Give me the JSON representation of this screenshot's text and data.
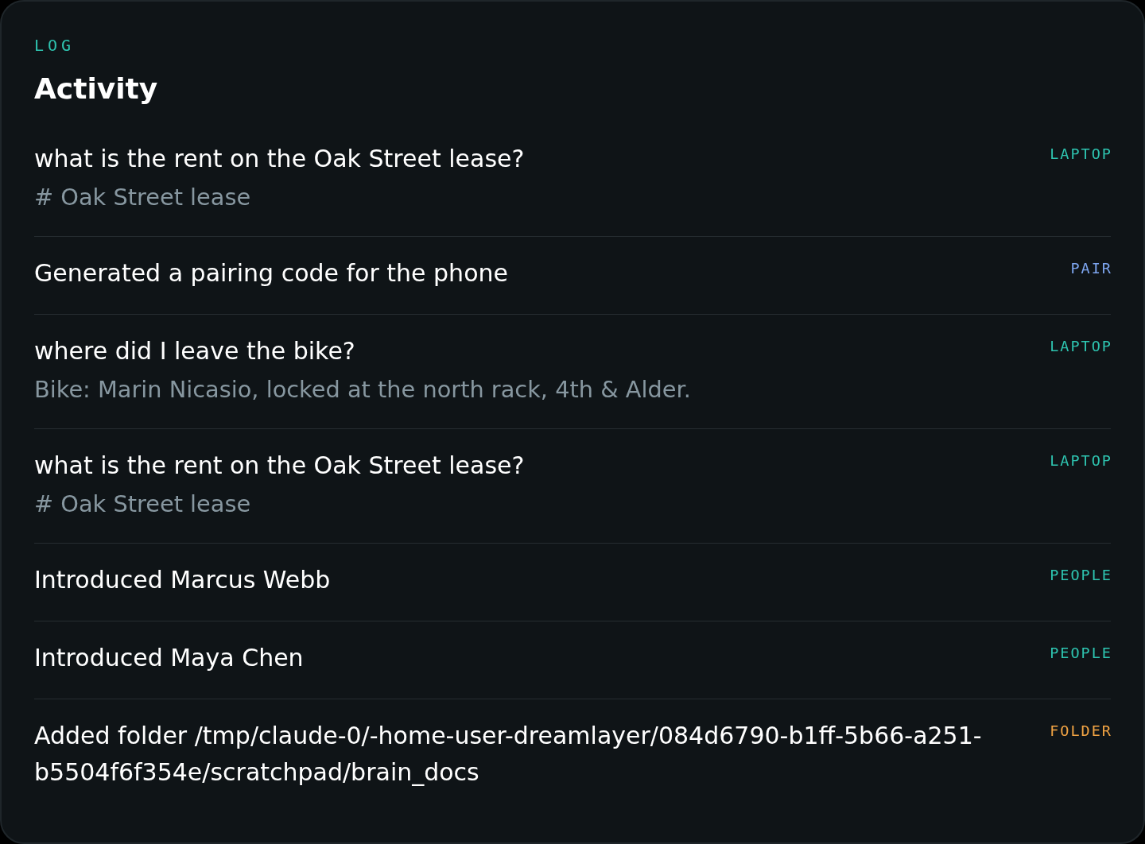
{
  "header": {
    "eyebrow": "LOG",
    "title": "Activity"
  },
  "entries": [
    {
      "text": "what is the rent on the Oak Street lease?",
      "detail": "# Oak Street lease",
      "tag": "LAPTOP",
      "color": "#2ec4b0"
    },
    {
      "text": "Generated a pairing code for the phone",
      "tag": "PAIR",
      "color": "#7ea6f0"
    },
    {
      "text": "where did I leave the bike?",
      "detail": "Bike: Marin Nicasio, locked at the north rack, 4th & Alder.",
      "tag": "LAPTOP",
      "color": "#2ec4b0"
    },
    {
      "text": "what is the rent on the Oak Street lease?",
      "detail": "# Oak Street lease",
      "tag": "LAPTOP",
      "color": "#2ec4b0"
    },
    {
      "text": "Introduced Marcus Webb",
      "tag": "PEOPLE",
      "color": "#2ec4b0"
    },
    {
      "text": "Introduced Maya Chen",
      "tag": "PEOPLE",
      "color": "#2ec4b0"
    },
    {
      "text": "Added folder /tmp/claude-0/-home-user-dreamlayer/084d6790-b1ff-5b66-a251-b5504f6f354e/scratchpad/brain_docs",
      "tag": "FOLDER",
      "color": "#f2a444"
    }
  ]
}
